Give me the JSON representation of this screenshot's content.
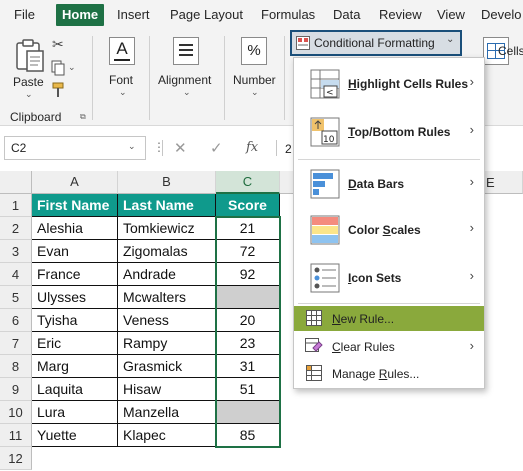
{
  "menubar": {
    "tabs": [
      {
        "label": "File"
      },
      {
        "label": "Home"
      },
      {
        "label": "Insert"
      },
      {
        "label": "Page Layout"
      },
      {
        "label": "Formulas"
      },
      {
        "label": "Data"
      },
      {
        "label": "Review"
      },
      {
        "label": "View"
      },
      {
        "label": "Develo"
      }
    ]
  },
  "ribbon": {
    "paste_label": "Paste",
    "clipboard_label": "Clipboard",
    "font_label": "Font",
    "alignment_label": "Alignment",
    "number_label": "Number",
    "number_symbol": "%",
    "font_symbol": "A",
    "conditional_formatting_label": "Conditional Formatting",
    "cells_label": "Cells"
  },
  "formula_bar": {
    "name_box": "C2",
    "fx": "fx",
    "value_fragment": "2"
  },
  "grid": {
    "columns": [
      "A",
      "B",
      "C"
    ],
    "rows": [
      "1",
      "2",
      "3",
      "4",
      "5",
      "6",
      "7",
      "8",
      "9",
      "10",
      "11",
      "12"
    ],
    "headers": [
      "First Name",
      "Last Name",
      "Score"
    ],
    "data": [
      {
        "first": "Aleshia",
        "last": "Tomkiewicz",
        "score": "21"
      },
      {
        "first": "Evan",
        "last": "Zigomalas",
        "score": "72"
      },
      {
        "first": "France",
        "last": "Andrade",
        "score": "92"
      },
      {
        "first": "Ulysses",
        "last": "Mcwalters",
        "score": ""
      },
      {
        "first": "Tyisha",
        "last": "Veness",
        "score": "20"
      },
      {
        "first": "Eric",
        "last": "Rampy",
        "score": "23"
      },
      {
        "first": "Marg",
        "last": "Grasmick",
        "score": "31"
      },
      {
        "first": "Laquita",
        "last": "Hisaw",
        "score": "51"
      },
      {
        "first": "Lura",
        "last": "Manzella",
        "score": ""
      },
      {
        "first": "Yuette",
        "last": "Klapec",
        "score": "85"
      }
    ],
    "partial_col_header": "E"
  },
  "dropdown": {
    "items": [
      {
        "label": "Highlight Cells Rules",
        "key": "H",
        "rest": "ighlight Cells Rules",
        "icon": "highlight-cells-icon",
        "submenu": true
      },
      {
        "label": "Top/Bottom Rules",
        "key": "T",
        "rest": "op/Bottom Rules",
        "icon": "top-bottom-icon",
        "submenu": true
      },
      {
        "label": "Data Bars",
        "key": "D",
        "rest": "ata Bars",
        "icon": "data-bars-icon",
        "submenu": true
      },
      {
        "label": "Color Scales",
        "pre": "Color ",
        "key": "S",
        "rest": "cales",
        "icon": "color-scales-icon",
        "submenu": true
      },
      {
        "label": "Icon Sets",
        "key": "I",
        "rest": "con Sets",
        "icon": "icon-sets-icon",
        "submenu": true
      },
      {
        "label": "New Rule...",
        "key": "N",
        "rest": "ew Rule...",
        "icon": "new-rule-icon",
        "submenu": false
      },
      {
        "label": "Clear Rules",
        "key": "C",
        "rest": "lear Rules",
        "icon": "clear-rules-icon",
        "submenu": true
      },
      {
        "label": "Manage Rules...",
        "pre": "Manage ",
        "key": "R",
        "rest": "ules...",
        "icon": "manage-rules-icon",
        "submenu": false
      }
    ]
  },
  "colors": {
    "accent_green": "#1e7145",
    "header_teal": "#0f9a8c",
    "highlight_olive": "#8aa93c",
    "blank_cell_gray": "#cfcfcf"
  }
}
